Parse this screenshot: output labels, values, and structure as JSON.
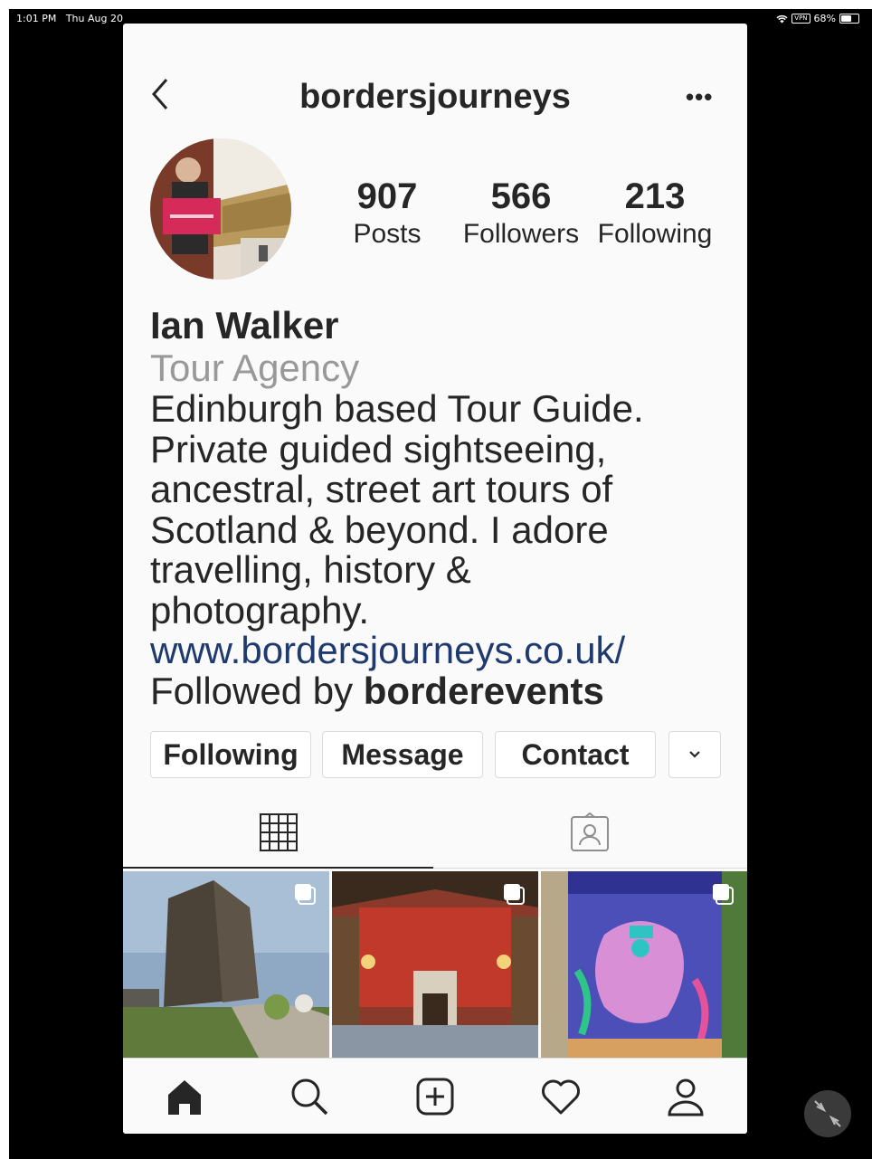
{
  "status_bar": {
    "time": "1:01 PM",
    "date": "Thu Aug 20",
    "vpn": "VPN",
    "battery": "68%",
    "battery_level": 0.68
  },
  "profile": {
    "username": "bordersjourneys",
    "stats": [
      {
        "value": "907",
        "label": "Posts"
      },
      {
        "value": "566",
        "label": "Followers"
      },
      {
        "value": "213",
        "label": "Following"
      }
    ],
    "name": "Ian Walker",
    "category": "Tour Agency",
    "bio_lines": [
      "Edinburgh based Tour Guide.",
      "Private guided sightseeing,",
      "ancestral, street art tours of",
      "Scotland & beyond. I adore",
      "travelling, history &",
      "photography."
    ],
    "website": "www.bordersjourneys.co.uk/",
    "followed_by_prefix": "Followed by",
    "followed_by_user": "borderevents"
  },
  "actions": {
    "following": "Following",
    "message": "Message",
    "contact": "Contact",
    "more_icon": "chevron-down-icon"
  },
  "tabs": [
    {
      "name": "grid",
      "icon": "grid-icon",
      "active": true
    },
    {
      "name": "tagged",
      "icon": "tagged-icon",
      "active": false
    }
  ],
  "nav_icons": [
    "home-icon",
    "search-icon",
    "new-post-icon",
    "activity-heart-icon",
    "profile-icon"
  ],
  "colors": {
    "link": "#1e3a6e",
    "text": "#262626",
    "muted": "#999999",
    "background": "#fafafa"
  }
}
